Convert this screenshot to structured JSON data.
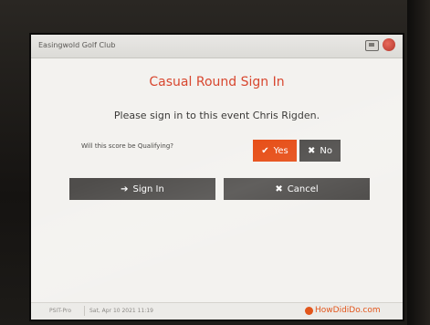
{
  "header": {
    "club_name": "Easingwold Golf Club",
    "icons": [
      "monitor-icon",
      "flag-icon"
    ]
  },
  "main": {
    "title": "Casual Round Sign In",
    "prompt": "Please sign in to this event Chris Rigden.",
    "question": "Will this score be Qualifying?",
    "yes_label": "Yes",
    "no_label": "No",
    "signin_label": "Sign In",
    "cancel_label": "Cancel",
    "selected_answer": "Yes"
  },
  "footer": {
    "product": "PSIT-Pro",
    "datetime": "Sat, Apr 10 2021 11:19",
    "brand": "HowDidiDo.com"
  },
  "colors": {
    "accent": "#e64a12",
    "title": "#d8472f",
    "button_dark": "#4f4d4b"
  }
}
